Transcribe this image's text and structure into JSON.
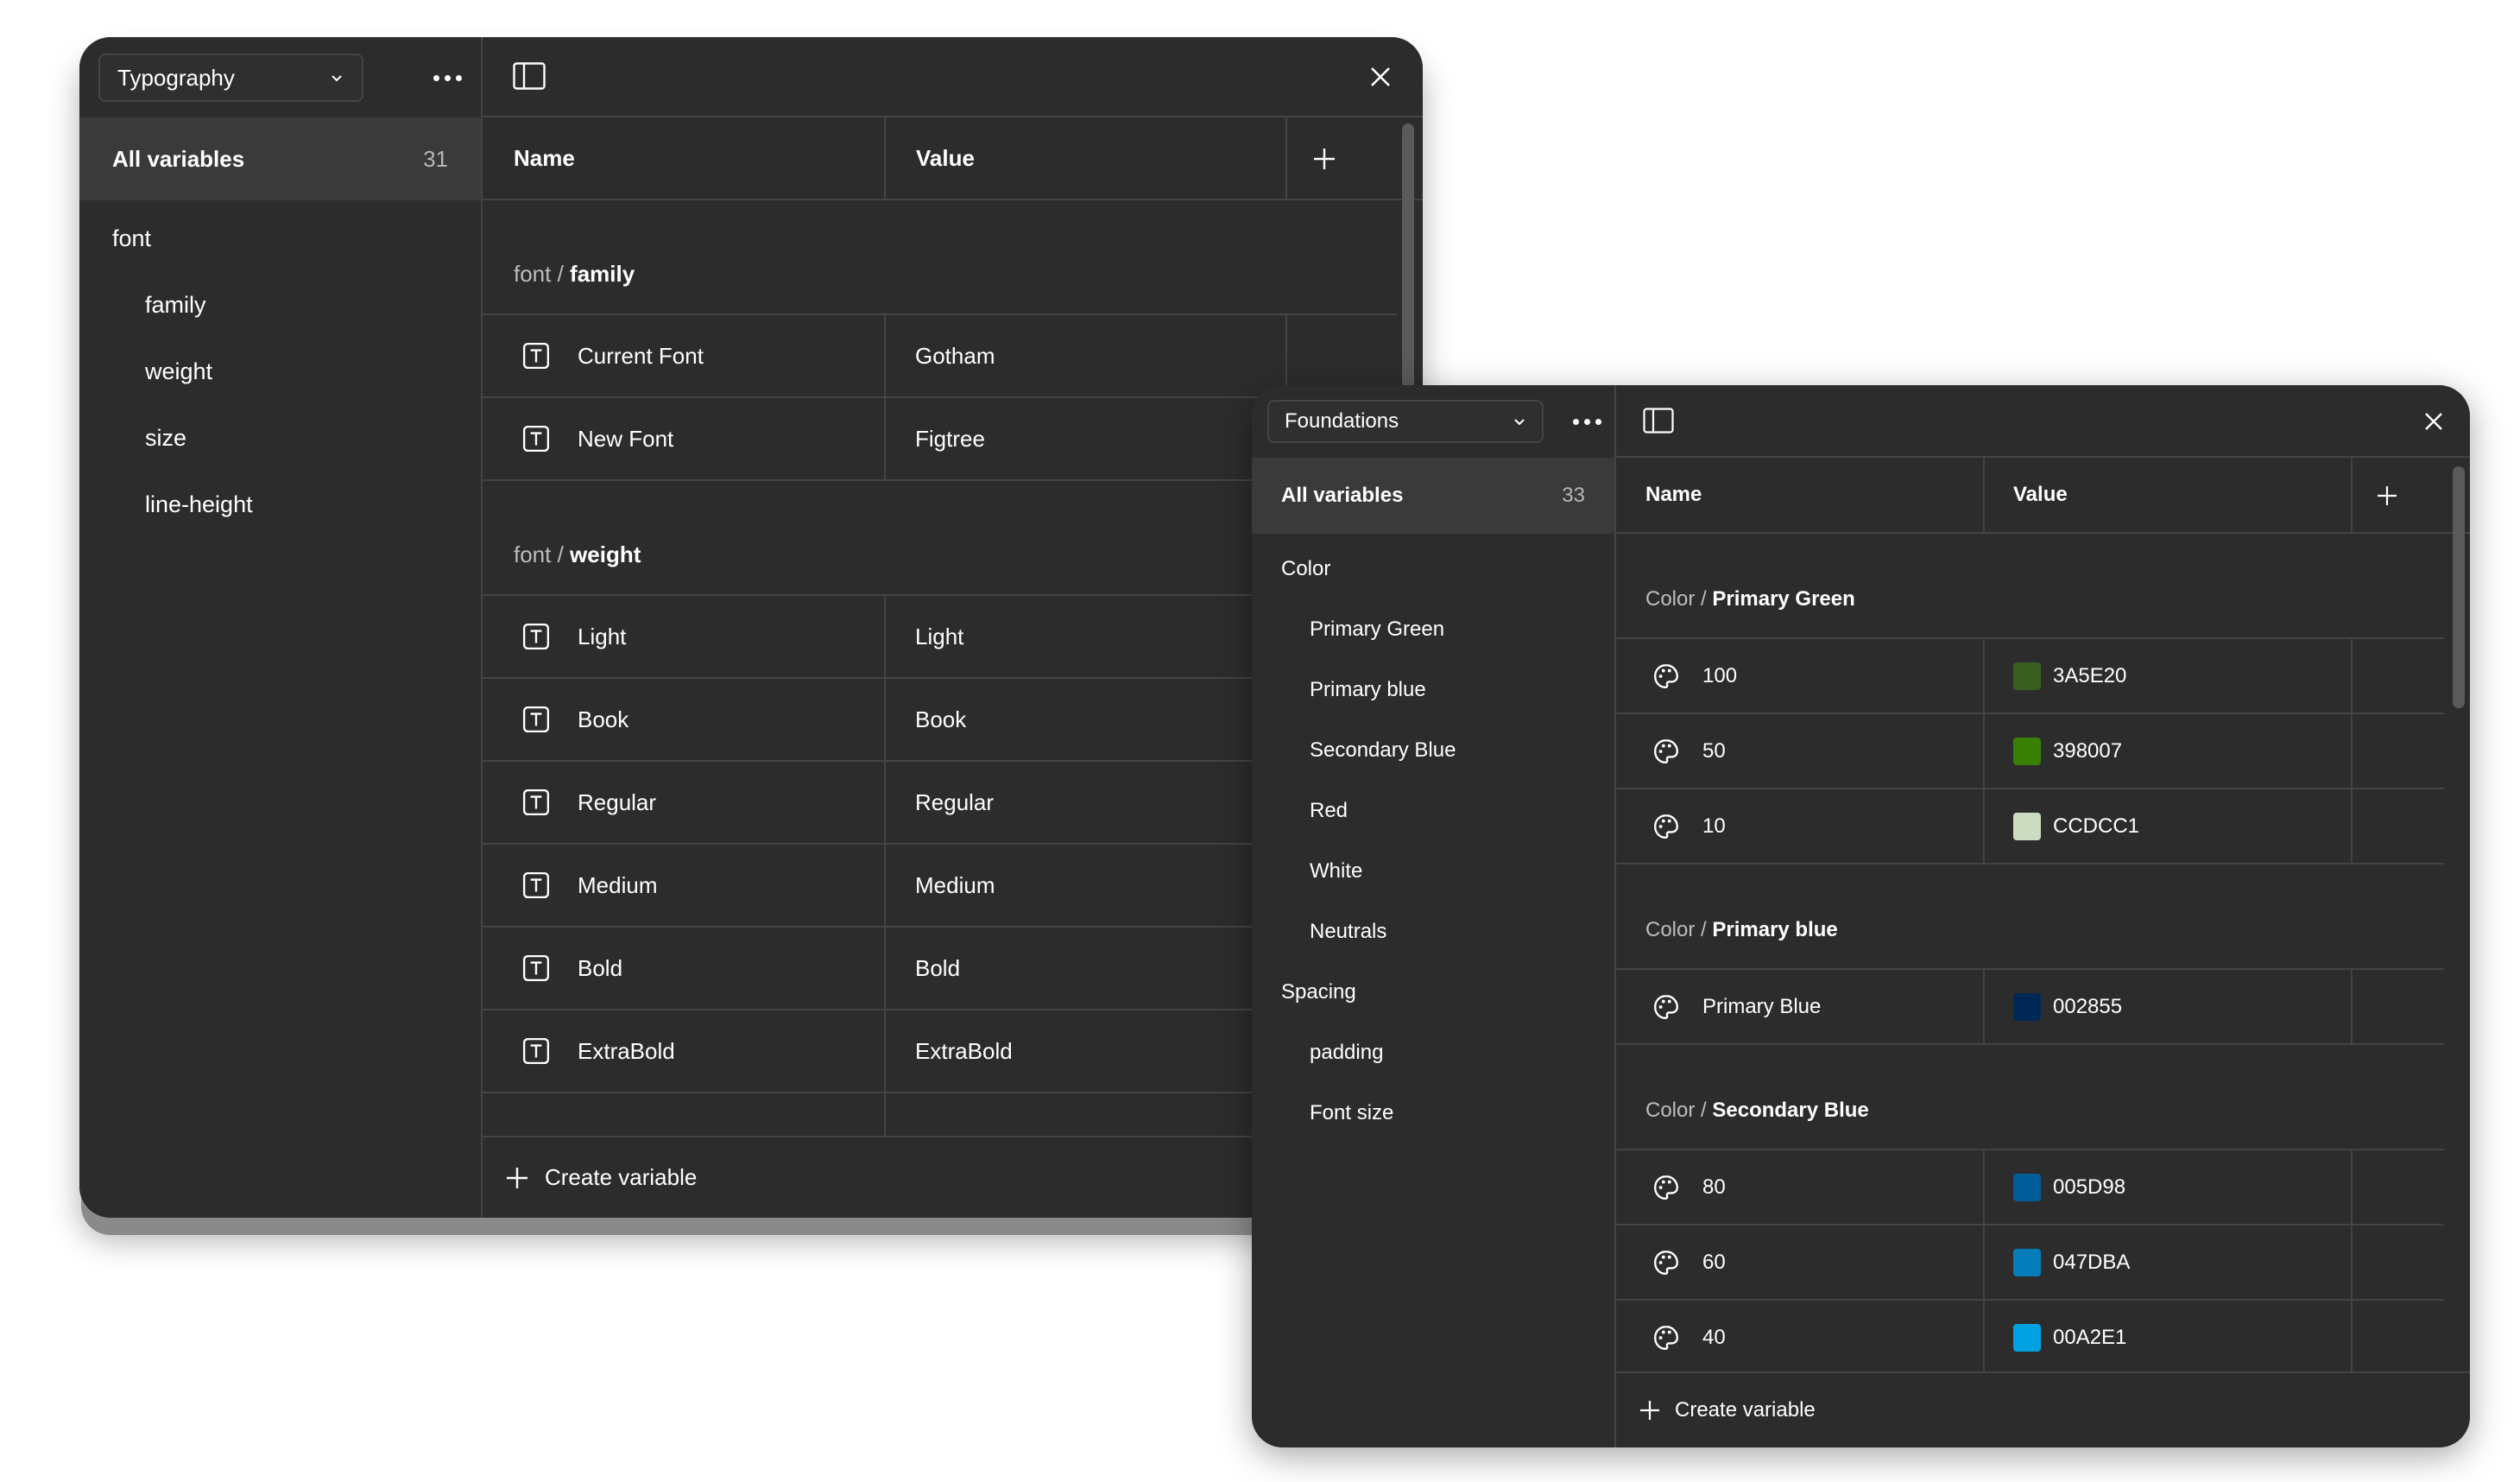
{
  "typography_panel": {
    "collection": "Typography",
    "all_variables_label": "All variables",
    "all_variables_count": "31",
    "groups": [
      {
        "label": "font",
        "level": 0
      },
      {
        "label": "family",
        "level": 1
      },
      {
        "label": "weight",
        "level": 1
      },
      {
        "label": "size",
        "level": 1
      },
      {
        "label": "line-height",
        "level": 1
      }
    ],
    "columns": {
      "name": "Name",
      "value": "Value"
    },
    "sections": [
      {
        "prefix": "font / ",
        "group": "family",
        "rows": [
          {
            "name": "Current Font",
            "value": "Gotham"
          },
          {
            "name": "New Font",
            "value": "Figtree"
          }
        ]
      },
      {
        "prefix": "font / ",
        "group": "weight",
        "rows": [
          {
            "name": "Light",
            "value": "Light"
          },
          {
            "name": "Book",
            "value": "Book"
          },
          {
            "name": "Regular",
            "value": "Regular"
          },
          {
            "name": "Medium",
            "value": "Medium"
          },
          {
            "name": "Bold",
            "value": "Bold"
          },
          {
            "name": "ExtraBold",
            "value": "ExtraBold"
          }
        ]
      }
    ],
    "create_label": "Create variable"
  },
  "foundations_panel": {
    "collection": "Foundations",
    "all_variables_label": "All variables",
    "all_variables_count": "33",
    "groups": [
      {
        "label": "Color",
        "level": 0
      },
      {
        "label": "Primary Green",
        "level": 1
      },
      {
        "label": "Primary blue",
        "level": 1
      },
      {
        "label": "Secondary Blue",
        "level": 1
      },
      {
        "label": "Red",
        "level": 1
      },
      {
        "label": "White",
        "level": 1
      },
      {
        "label": "Neutrals",
        "level": 1
      },
      {
        "label": "Spacing",
        "level": 0
      },
      {
        "label": "padding",
        "level": 1
      },
      {
        "label": "Font size",
        "level": 1
      }
    ],
    "columns": {
      "name": "Name",
      "value": "Value"
    },
    "sections": [
      {
        "prefix": "Color / ",
        "group": "Primary Green",
        "rows": [
          {
            "name": "100",
            "value": "3A5E20",
            "color": "#3A5E20"
          },
          {
            "name": "50",
            "value": "398007",
            "color": "#398007"
          },
          {
            "name": "10",
            "value": "CCDCC1",
            "color": "#CCDCC1"
          }
        ]
      },
      {
        "prefix": "Color / ",
        "group": "Primary blue",
        "rows": [
          {
            "name": "Primary Blue",
            "value": "002855",
            "color": "#002855"
          }
        ]
      },
      {
        "prefix": "Color / ",
        "group": "Secondary Blue",
        "rows": [
          {
            "name": "80",
            "value": "005D98",
            "color": "#005D98"
          },
          {
            "name": "60",
            "value": "047DBA",
            "color": "#047DBA"
          },
          {
            "name": "40",
            "value": "00A2E1",
            "color": "#00A2E1"
          }
        ]
      }
    ],
    "create_label": "Create variable"
  }
}
